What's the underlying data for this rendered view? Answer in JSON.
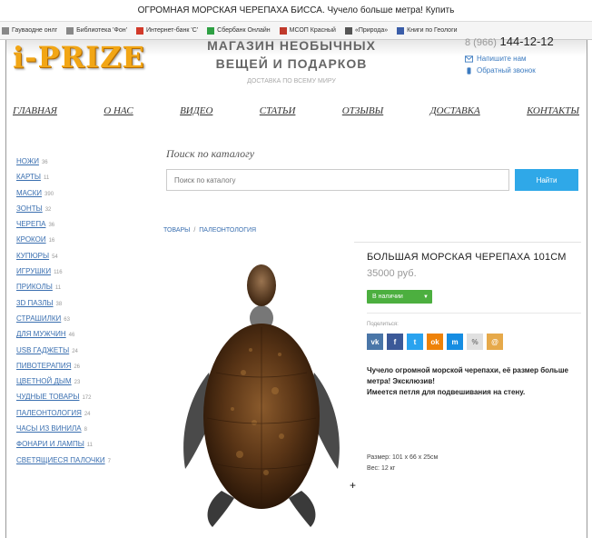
{
  "window": {
    "title": "ОГРОМНАЯ МОРСКАЯ ЧЕРЕПАХА БИССА. Чучело больше метра! Купить"
  },
  "bookmarks": [
    {
      "label": "Гауваодне онлг",
      "icon": "page-icon",
      "color": "#888888"
    },
    {
      "label": "Библиотека 'Фон'",
      "icon": "page-icon",
      "color": "#888888"
    },
    {
      "label": "Интернет-банк 'С'",
      "icon": "bank-icon",
      "color": "#d23a2a"
    },
    {
      "label": "Сбербанк Онлайн",
      "icon": "sber-icon",
      "color": "#2ea043"
    },
    {
      "label": "МСОП Красный",
      "icon": "flag-icon",
      "color": "#c0392b"
    },
    {
      "label": "«Природа»",
      "icon": "book-icon",
      "color": "#555555"
    },
    {
      "label": "Книги по Геологи",
      "icon": "bookmark-icon",
      "color": "#3a5da8"
    }
  ],
  "site": {
    "logo": "i-PRIZE",
    "tagline_1": "МАГАЗИН НЕОБЫЧНЫХ",
    "tagline_2": "ВЕЩЕЙ И ПОДАРКОВ",
    "subtagline": "ДОСТАВКА ПО ВСЕМУ МИРУ",
    "phone_prefix": "8 (966)",
    "phone_number": "144-12-12",
    "write_us": "Напишите нам",
    "callback": "Обратный звонок"
  },
  "nav": [
    "ГЛАВНАЯ",
    "О НАС",
    "ВИДЕО",
    "СТАТЬИ",
    "ОТЗЫВЫ",
    "ДОСТАВКА",
    "КОНТАКТЫ"
  ],
  "sidebar": {
    "categories": [
      {
        "name": "НОЖИ",
        "count": "36"
      },
      {
        "name": "КАРТЫ",
        "count": "11"
      },
      {
        "name": "МАСКИ",
        "count": "390"
      },
      {
        "name": "ЗОНТЫ",
        "count": "32"
      },
      {
        "name": "ЧЕРЕПА",
        "count": "36"
      },
      {
        "name": "КРОКОИ",
        "count": "16"
      },
      {
        "name": "КУПЮРЫ",
        "count": "54"
      },
      {
        "name": "ИГРУШКИ",
        "count": "116"
      },
      {
        "name": "ПРИКОЛЫ",
        "count": "11"
      },
      {
        "name": "3D ПАЗЛЫ",
        "count": "38"
      },
      {
        "name": "СТРАШИЛКИ",
        "count": "63"
      },
      {
        "name": "ДЛЯ МУЖЧИН",
        "count": "46"
      },
      {
        "name": "USB ГАДЖЕТЫ",
        "count": "24"
      },
      {
        "name": "ПИВОТЕРАПИЯ",
        "count": "26"
      },
      {
        "name": "ЦВЕТНОЙ ДЫМ",
        "count": "23"
      },
      {
        "name": "ЧУДНЫЕ ТОВАРЫ",
        "count": "172"
      },
      {
        "name": "ПАЛЕОНТОЛОГИЯ",
        "count": "24"
      },
      {
        "name": "ЧАСЫ ИЗ ВИНИЛА",
        "count": "8"
      },
      {
        "name": "ФОНАРИ И ЛАМПЫ",
        "count": "11"
      },
      {
        "name": "СВЕТЯЩИЕСЯ ПАЛОЧКИ",
        "count": "7"
      }
    ]
  },
  "search": {
    "title": "Поиск по каталогу",
    "placeholder": "Поиск по каталогу",
    "button": "Найти"
  },
  "breadcrumb": {
    "root": "ТОВАРЫ",
    "separator": "/",
    "current": "ПАЛЕОНТОЛОГИЯ"
  },
  "product": {
    "title": "БОЛЬШАЯ МОРСКАЯ ЧЕРЕПАХА 101СМ",
    "price": "35000 руб.",
    "stock": "В наличии",
    "share_label": "Поделиться:",
    "share": [
      {
        "label": "vk",
        "icon": "vk-icon",
        "color": "#4a76a8"
      },
      {
        "label": "f",
        "icon": "facebook-icon",
        "color": "#3b5998"
      },
      {
        "label": "t",
        "icon": "twitter-icon",
        "color": "#2aa3ef"
      },
      {
        "label": "ok",
        "icon": "odnoklassniki-icon",
        "color": "#ee8208"
      },
      {
        "label": "m",
        "icon": "mailru-icon",
        "color": "#168de2"
      },
      {
        "label": "%",
        "icon": "link-icon",
        "color": "#e0e0e0"
      },
      {
        "label": "@",
        "icon": "mail-icon",
        "color": "#e6a94a"
      }
    ],
    "desc_1": "Чучело огромной морской черепахи, её размер больше метра! Эксклюзив!",
    "desc_2": "Имеется петля для подвешивания на стену.",
    "size": "Размер: 101 х 66 х 25см",
    "weight": "Вес: 12 кг"
  }
}
